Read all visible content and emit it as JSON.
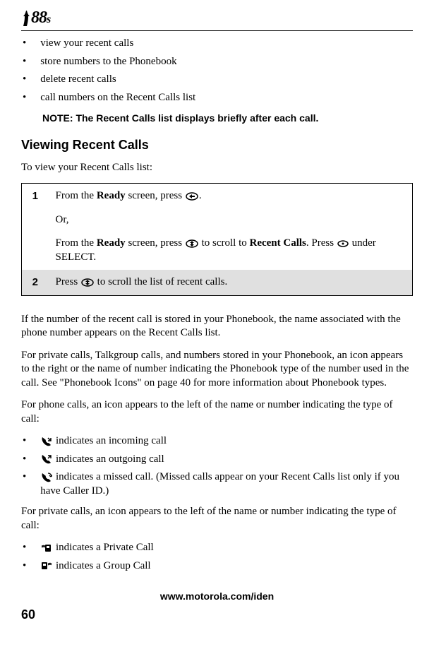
{
  "header": {
    "logo_text": "88",
    "logo_suffix": "s"
  },
  "intro_bullets": [
    "view your recent calls",
    "store numbers to the Phonebook",
    "delete recent calls",
    "call numbers on the Recent Calls list"
  ],
  "note": {
    "label": "NOTE:",
    "text": "The Recent Calls list displays briefly after each call."
  },
  "section_title": "Viewing Recent Calls",
  "intro_text": "To view your Recent Calls list:",
  "steps": [
    {
      "num": "1",
      "parts": {
        "a_prefix": "From the ",
        "a_bold": "Ready",
        "a_suffix": " screen, press ",
        "a_end": ".",
        "or": "Or,",
        "b_prefix": "From the ",
        "b_bold1": "Ready",
        "b_mid": " screen, press ",
        "b_mid2": " to scroll to ",
        "b_bold2": "Recent Calls",
        "b_suffix": ". Press ",
        "b_end": " under SELECT."
      }
    },
    {
      "num": "2",
      "parts": {
        "prefix": "Press ",
        "suffix": " to scroll the list of recent calls."
      }
    }
  ],
  "para1": "If the number of the recent call is stored in your Phonebook, the name associated with the phone number appears on the Recent Calls list.",
  "para2": "For private calls, Talkgroup calls, and numbers stored in your Phonebook, an icon appears to the right or the name of number indicating the Phonebook type of the number used in the call. See \"Phonebook Icons\" on page 40 for more information about Phonebook types.",
  "para3": "For phone calls, an icon appears to the left of the name or number indicating the type of call:",
  "phone_icons": [
    {
      "text": " indicates an incoming call"
    },
    {
      "text": " indicates an outgoing call"
    },
    {
      "text": " indicates a missed call. (Missed calls appear on your Recent Calls list only if you have Caller ID.)"
    }
  ],
  "para4": "For private calls, an icon appears to the left of the name or number indicating the type of call:",
  "private_icons": [
    {
      "text": " indicates a Private Call"
    },
    {
      "text": " indicates a Group Call"
    }
  ],
  "footer_url": "www.motorola.com/iden",
  "page_number": "60"
}
